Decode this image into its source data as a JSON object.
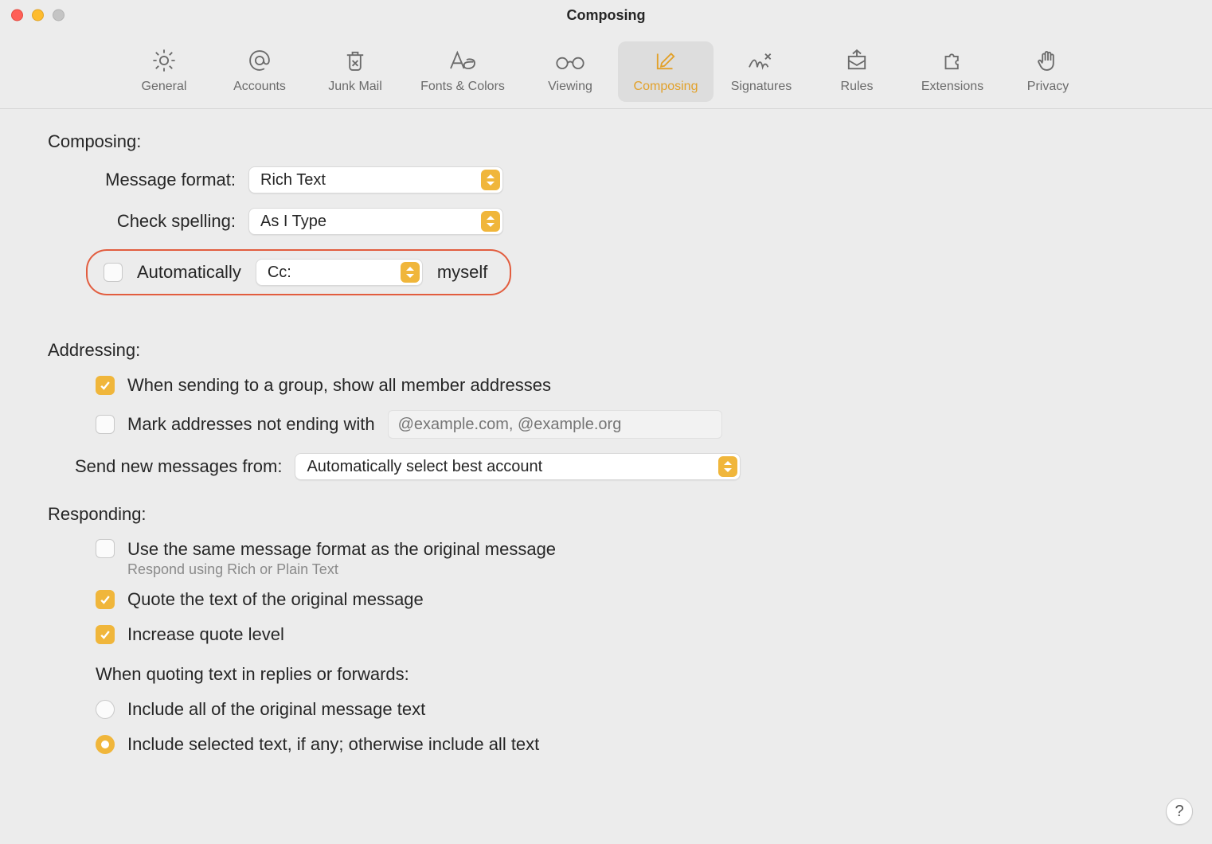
{
  "window": {
    "title": "Composing"
  },
  "toolbar": {
    "items": [
      {
        "id": "general",
        "label": "General"
      },
      {
        "id": "accounts",
        "label": "Accounts"
      },
      {
        "id": "junk",
        "label": "Junk Mail"
      },
      {
        "id": "fonts",
        "label": "Fonts & Colors"
      },
      {
        "id": "viewing",
        "label": "Viewing"
      },
      {
        "id": "composing",
        "label": "Composing"
      },
      {
        "id": "signatures",
        "label": "Signatures"
      },
      {
        "id": "rules",
        "label": "Rules"
      },
      {
        "id": "extensions",
        "label": "Extensions"
      },
      {
        "id": "privacy",
        "label": "Privacy"
      }
    ],
    "active_id": "composing"
  },
  "composing": {
    "section_label": "Composing:",
    "message_format": {
      "label": "Message format:",
      "value": "Rich Text"
    },
    "check_spelling": {
      "label": "Check spelling:",
      "value": "As I Type"
    },
    "auto_cc": {
      "checked": false,
      "checkbox_label": "Automatically",
      "mode_value": "Cc:",
      "suffix": "myself"
    }
  },
  "addressing": {
    "section_label": "Addressing:",
    "group_expand": {
      "checked": true,
      "label": "When sending to a group, show all member addresses"
    },
    "mark_external": {
      "checked": false,
      "label": "Mark addresses not ending with",
      "placeholder": "@example.com, @example.org"
    },
    "send_from": {
      "label": "Send new messages from:",
      "value": "Automatically select best account"
    }
  },
  "responding": {
    "section_label": "Responding:",
    "same_format": {
      "checked": false,
      "label": "Use the same message format as the original message",
      "hint": "Respond using Rich or Plain Text"
    },
    "quote_text": {
      "checked": true,
      "label": "Quote the text of the original message"
    },
    "increase_quote": {
      "checked": true,
      "label": "Increase quote level"
    },
    "quoting_heading": "When quoting text in replies or forwards:",
    "radio_all": {
      "selected": false,
      "label": "Include all of the original message text"
    },
    "radio_selected": {
      "selected": true,
      "label": "Include selected text, if any; otherwise include all text"
    }
  },
  "help_button": {
    "label": "?"
  }
}
